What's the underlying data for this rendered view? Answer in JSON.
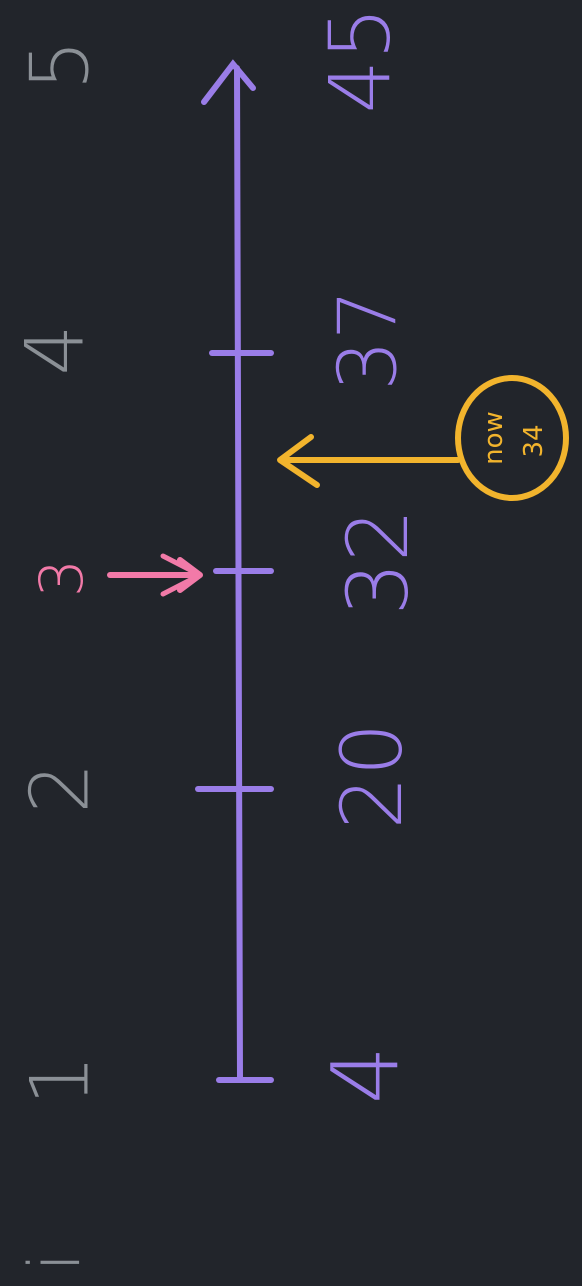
{
  "colors": {
    "background": "#22252b",
    "axis": "#9a7de8",
    "index_labels": "#8b9096",
    "marker": "#f27aa8",
    "current": "#f2b42d"
  },
  "row_labels": [
    "i",
    "1",
    "2",
    "3",
    "4",
    "5"
  ],
  "axis_values": [
    "4",
    "20",
    "32",
    "37",
    "45"
  ],
  "marker": {
    "label": "3",
    "target_value": 32
  },
  "current": {
    "label": "now",
    "value": "34",
    "target_value": 34
  }
}
